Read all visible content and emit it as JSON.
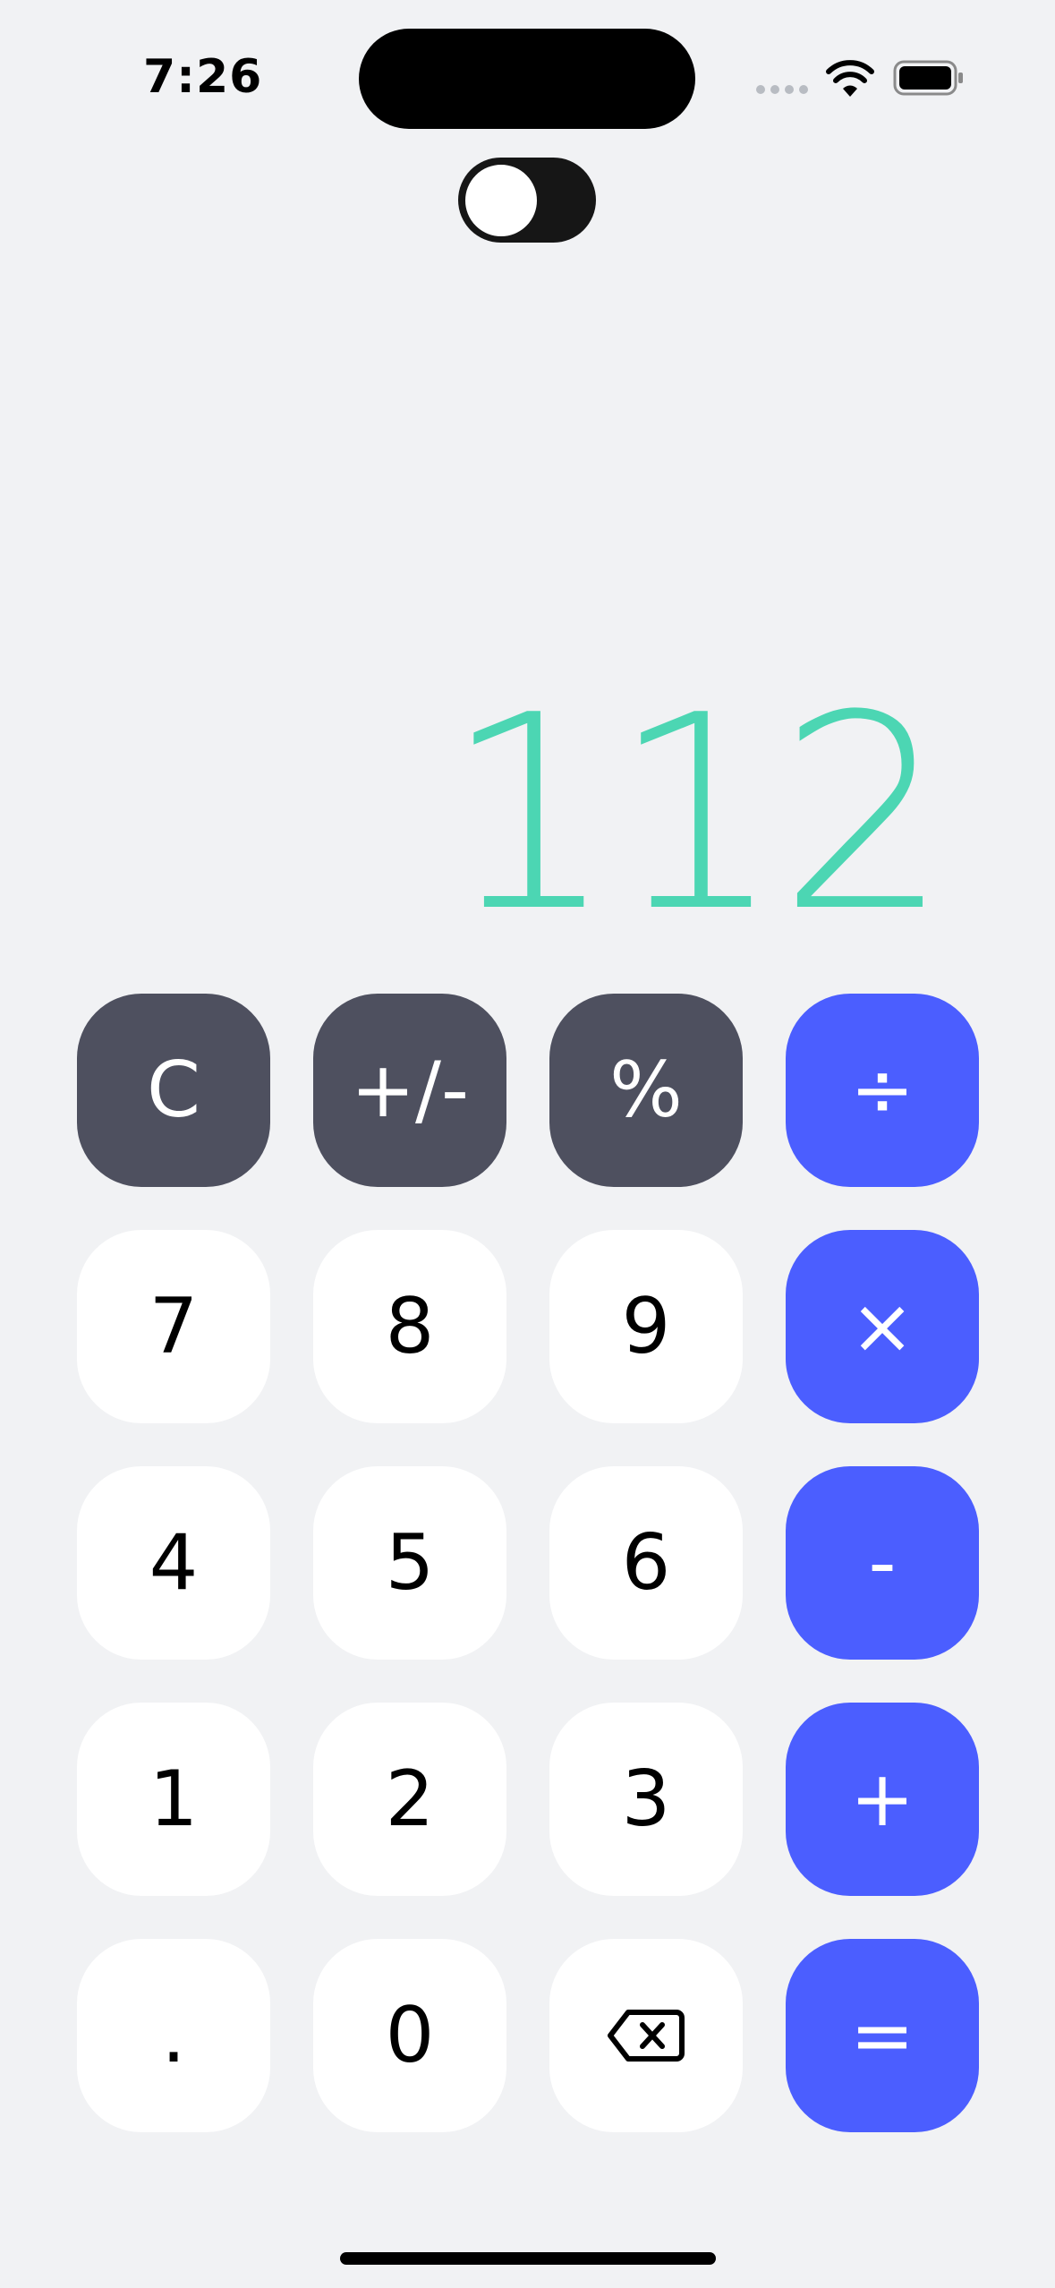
{
  "status_bar": {
    "time": "7:26",
    "icons": [
      "cellular-signal-icon",
      "wifi-icon",
      "battery-icon"
    ]
  },
  "theme_toggle": {
    "state": "off"
  },
  "display": {
    "value": "112"
  },
  "keys": {
    "clear": "C",
    "sign": "+/-",
    "percent": "%",
    "divide": "÷",
    "seven": "7",
    "eight": "8",
    "nine": "9",
    "multiply": "×",
    "four": "4",
    "five": "5",
    "six": "6",
    "subtract": "-",
    "one": "1",
    "two": "2",
    "three": "3",
    "add": "+",
    "decimal": ".",
    "zero": "0",
    "backspace_icon": "backspace-icon",
    "equals": "="
  },
  "colors": {
    "background": "#f1f2f4",
    "display_text": "#4cd6b3",
    "function_key": "#4e505f",
    "operator_key": "#4b5eff",
    "number_key": "#ffffff"
  }
}
